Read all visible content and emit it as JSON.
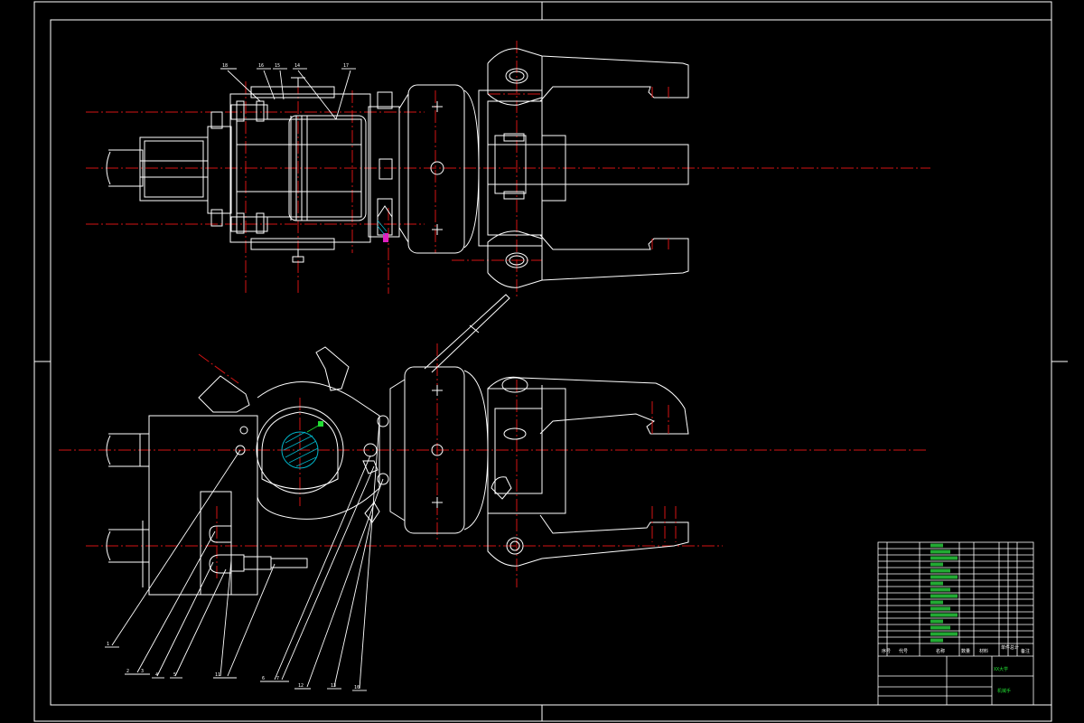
{
  "drawing": {
    "background": "#000000",
    "line_color": "#ffffff",
    "centerline_color": "#d41414",
    "title_text_color": "#22dd33",
    "views": [
      "top-view",
      "front-view"
    ]
  },
  "balloons": {
    "top_view": [
      "18",
      "16",
      "15",
      "14",
      "17"
    ],
    "front_view": [
      "1",
      "2",
      "3",
      "4",
      "5",
      "11",
      "6",
      "7",
      "12",
      "13",
      "10"
    ]
  },
  "title_block": {
    "parts_rows": 16,
    "header": [
      "序号",
      "代号",
      "名称",
      "数量",
      "材料",
      "单件",
      "总计",
      "备注"
    ],
    "drawing_name": "机械手",
    "school": "XX大学"
  }
}
